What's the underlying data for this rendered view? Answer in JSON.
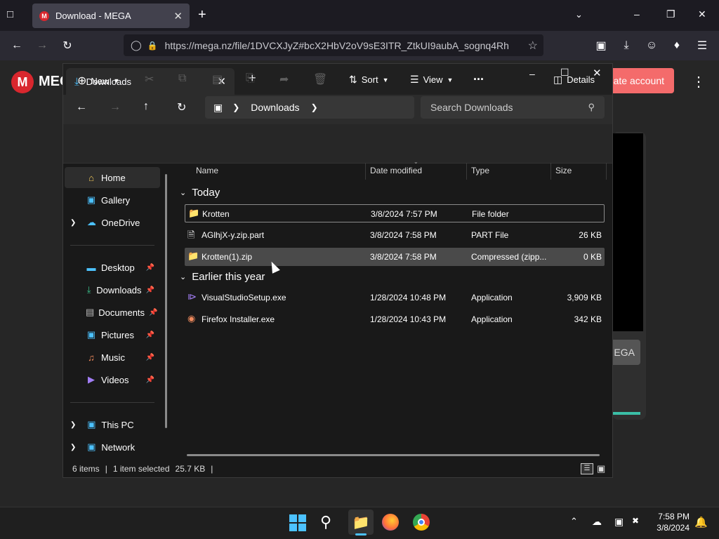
{
  "browser": {
    "tab_title": "Download - MEGA",
    "url": "https://mega.nz/file/1DVCXJyZ#bcX2HbV2oV9sE3ITR_ZtkUI9aubA_sognq4RhX6L"
  },
  "mega": {
    "logo_letter": "M",
    "logo_text": "MEG",
    "create_account_label": "ate account",
    "side_button_label": "EGA"
  },
  "explorer": {
    "tab_title": "Downloads",
    "breadcrumb": "Downloads",
    "search_placeholder": "Search Downloads",
    "toolbar": {
      "new": "New",
      "sort": "Sort",
      "view": "View",
      "more": "...",
      "details": "Details"
    },
    "nav": {
      "home": "Home",
      "gallery": "Gallery",
      "onedrive": "OneDrive",
      "desktop": "Desktop",
      "downloads": "Downloads",
      "documents": "Documents",
      "pictures": "Pictures",
      "music": "Music",
      "videos": "Videos",
      "thispc": "This PC",
      "network": "Network"
    },
    "columns": {
      "name": "Name",
      "date": "Date modified",
      "type": "Type",
      "size": "Size"
    },
    "groups": {
      "today": "Today",
      "earlier": "Earlier this year"
    },
    "files": [
      {
        "name": "Krotten",
        "date": "3/8/2024 7:57 PM",
        "type": "File folder",
        "size": ""
      },
      {
        "name": "AGlhjX-y.zip.part",
        "date": "3/8/2024 7:58 PM",
        "type": "PART File",
        "size": "26 KB"
      },
      {
        "name": "Krotten(1).zip",
        "date": "3/8/2024 7:58 PM",
        "type": "Compressed (zipp...",
        "size": "0 KB"
      },
      {
        "name": "VisualStudioSetup.exe",
        "date": "1/28/2024 10:48 PM",
        "type": "Application",
        "size": "3,909 KB"
      },
      {
        "name": "Firefox Installer.exe",
        "date": "1/28/2024 10:43 PM",
        "type": "Application",
        "size": "342 KB"
      }
    ],
    "status": {
      "items": "6 items",
      "selected": "1 item selected",
      "size": "25.7 KB"
    }
  },
  "taskbar": {
    "time": "7:58 PM",
    "date": "3/8/2024"
  },
  "colors": {
    "mega_red": "#d9272e",
    "accent_button": "#f46b6b",
    "selection": "#4a4a4a",
    "teal": "#3bbfa7"
  }
}
